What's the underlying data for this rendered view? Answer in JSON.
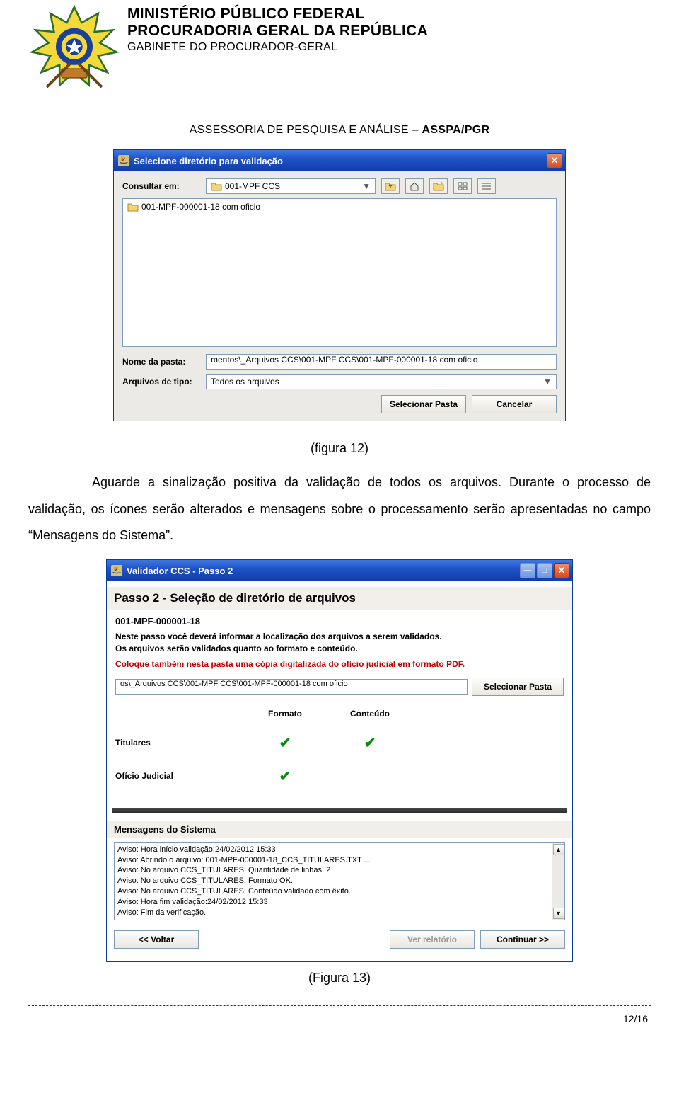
{
  "header": {
    "line1": "MINISTÉRIO PÚBLICO FEDERAL",
    "line2": "PROCURADORIA GERAL DA REPÚBLICA",
    "line3": "GABINETE DO PROCURADOR-GERAL",
    "subhead_plain": "ASSESSORIA DE PESQUISA E ANÁLISE – ",
    "subhead_bold": "ASSPA/PGR"
  },
  "dialog1": {
    "title": "Selecione diretório para validação",
    "consult_label": "Consultar em:",
    "consult_value": "001-MPF CCS",
    "listing_item": "001-MPF-000001-18 com oficio",
    "folder_label": "Nome da pasta:",
    "folder_value": "mentos\\_Arquivos CCS\\001-MPF CCS\\001-MPF-000001-18 com oficio",
    "type_label": "Arquivos de tipo:",
    "type_value": "Todos os arquivos",
    "btn_select": "Selecionar Pasta",
    "btn_cancel": "Cancelar"
  },
  "body": {
    "caption1": "(figura 12)",
    "paragraph": "Aguarde a sinalização positiva da validação de todos os arquivos. Durante o processo de validação, os ícones serão alterados e mensagens sobre o processamento serão apresentadas no campo “Mensagens do Sistema”.",
    "caption2": "(Figura 13)"
  },
  "dialog2": {
    "title": "Validador CCS - Passo 2",
    "step_title": "Passo 2 - Seleção de diretório de arquivos",
    "case_no": "001-MPF-000001-18",
    "instr1": "Neste passo você deverá informar a localização dos arquivos a serem validados.",
    "instr2": "Os arquivos serão validados quanto ao formato e conteúdo.",
    "red_note": "Coloque também nesta pasta uma cópia digitalizada do ofício judicial em formato PDF.",
    "path_value": "os\\_Arquivos CCS\\001-MPF CCS\\001-MPF-000001-18 com oficio",
    "btn_select": "Selecionar Pasta",
    "col_format": "Formato",
    "col_content": "Conteúdo",
    "row1": "Titulares",
    "row2": "Ofício Judicial",
    "msg_title": "Mensagens do Sistema",
    "messages": [
      "Aviso: Hora início validação:24/02/2012 15:33",
      "Aviso: Abrindo o arquivo: 001-MPF-000001-18_CCS_TITULARES.TXT ...",
      "Aviso: No arquivo CCS_TITULARES: Quantidade de linhas: 2",
      "Aviso: No arquivo CCS_TITULARES: Formato OK.",
      "Aviso: No arquivo CCS_TITULARES: Conteúdo validado com êxito.",
      "Aviso: Hora fim validação:24/02/2012 15:33",
      "Aviso: Fim da verificação."
    ],
    "btn_back": "<< Voltar",
    "btn_report": "Ver relatório",
    "btn_next": "Continuar >>"
  },
  "footer": {
    "page_num": "12/16"
  }
}
